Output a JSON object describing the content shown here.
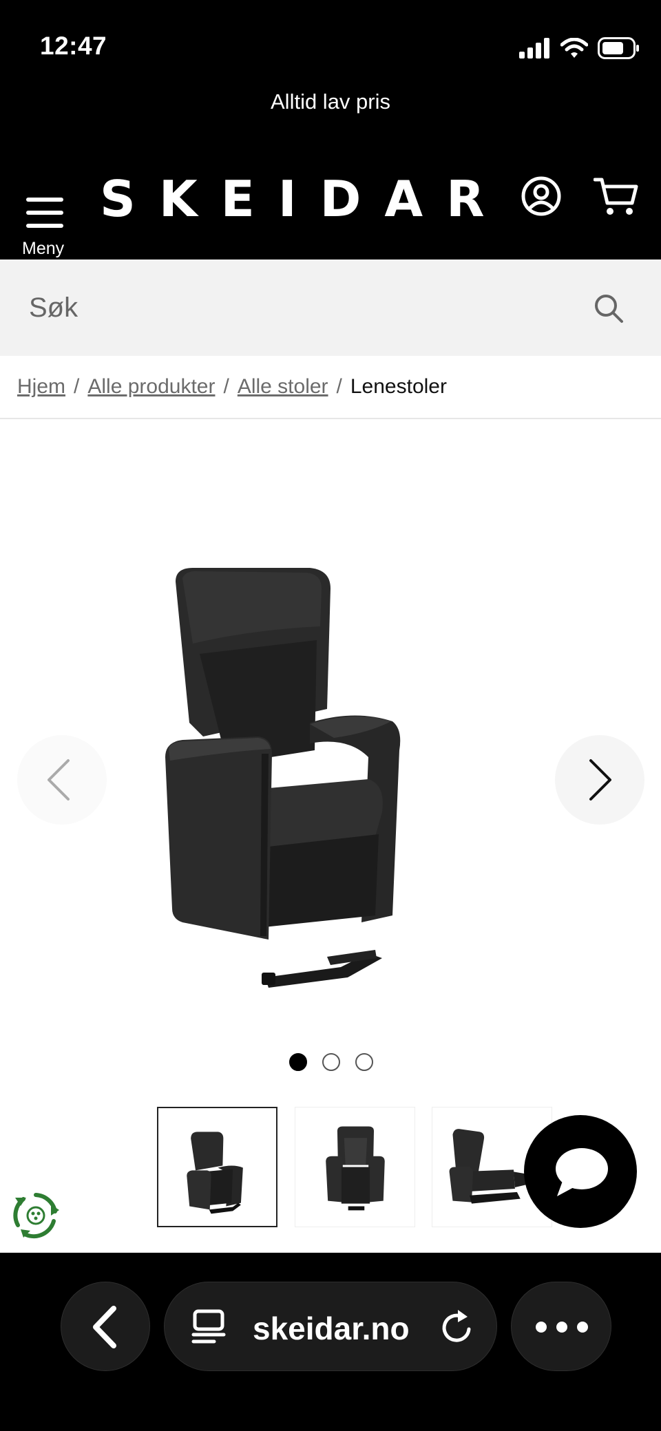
{
  "status_bar": {
    "time": "12:47"
  },
  "promo": {
    "text": "Alltid lav pris"
  },
  "header": {
    "menu_label": "Meny",
    "logo": "SKEIDAR"
  },
  "search": {
    "placeholder": "Søk"
  },
  "breadcrumb": {
    "items": [
      "Hjem",
      "Alle produkter",
      "Alle stoler"
    ],
    "current": "Lenestoler"
  },
  "gallery": {
    "image_alt": "black leather recliner lift chair",
    "active_index": 1,
    "total_images": 3
  },
  "browser": {
    "url": "skeidar.no"
  },
  "icons": {
    "menu": "menu-icon",
    "account": "account-icon",
    "cart": "cart-icon",
    "search": "search-icon",
    "prev": "chevron-left-icon",
    "next": "chevron-right-icon",
    "chat": "chat-icon",
    "eco": "recycle-icon",
    "back": "back-icon",
    "reader": "reader-icon",
    "reload": "reload-icon",
    "more": "more-icon"
  },
  "colors": {
    "header_bg": "#000000",
    "search_bg": "#f2f2f2",
    "text_muted": "#6b6b6b",
    "eco_green": "#2e7d32"
  }
}
